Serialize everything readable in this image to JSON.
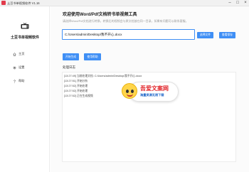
{
  "window": {
    "title": "土豆书单视频软件 V1.16",
    "minimize_glyph": "–",
    "maximize_glyph": "□",
    "close_glyph": "×"
  },
  "sidebar": {
    "logo_icon": "tv-icon",
    "logo_text": "土豆书单视频软件",
    "items": [
      {
        "icon": "home-icon",
        "label": "主页"
      },
      {
        "icon": "gear-icon",
        "label": "设置"
      },
      {
        "icon": "help-icon",
        "label": "帮助"
      }
    ]
  },
  "main": {
    "heading": "欢迎使用Word/Pdf文档转书单视频工具",
    "subtext": "请选择Word/Pdf文档进行转换，转换后的视频会与原文档放在同一目录，如果有问题可以联系客服。",
    "path_value": "C:/Users/admin/Desktop/我不开心.docx",
    "buttons": {
      "select_file": "选择文件",
      "open_folder": "查看保存",
      "start": "开始生成",
      "help": "使用帮助"
    },
    "log_label": "处理日志",
    "log_lines": [
      "[13:27:49] 当前处理文档: C:/Users/admin/Desktop/我不开心.docx",
      "[13:27:51] 开始分析",
      "[13:27:52] 开始处理",
      "[13:27:52] 开始处理",
      "[13:27:52] 正在生成视频"
    ]
  },
  "watermark": {
    "title": "吾爱文案网",
    "subtitle": "海量资源无限下载"
  },
  "colors": {
    "accent": "#3f8ff5",
    "app_icon": "#e23b4b",
    "watermark_red": "#e2262b",
    "watermark_blue": "#1e66c8"
  }
}
